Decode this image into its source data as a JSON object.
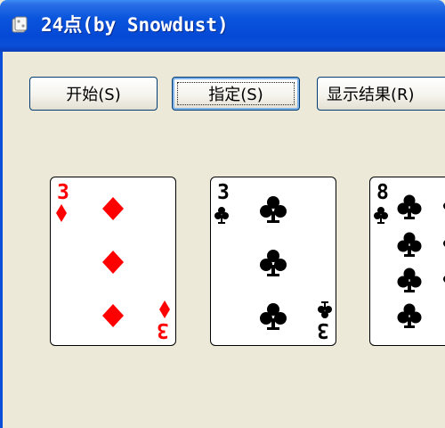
{
  "window": {
    "title": "24点(by Snowdust)"
  },
  "buttons": {
    "start": "开始(S)",
    "assign": "指定(S)",
    "show_result": "显示结果(R)"
  },
  "cards": [
    {
      "rank": "3",
      "suit": "diamonds",
      "color": "#ff0000"
    },
    {
      "rank": "3",
      "suit": "clubs",
      "color": "#000000"
    },
    {
      "rank": "8",
      "suit": "clubs",
      "color": "#000000"
    }
  ],
  "colors": {
    "titlebar": "#0a55dd",
    "face": "#ece9d8",
    "button_border": "#003c74"
  }
}
